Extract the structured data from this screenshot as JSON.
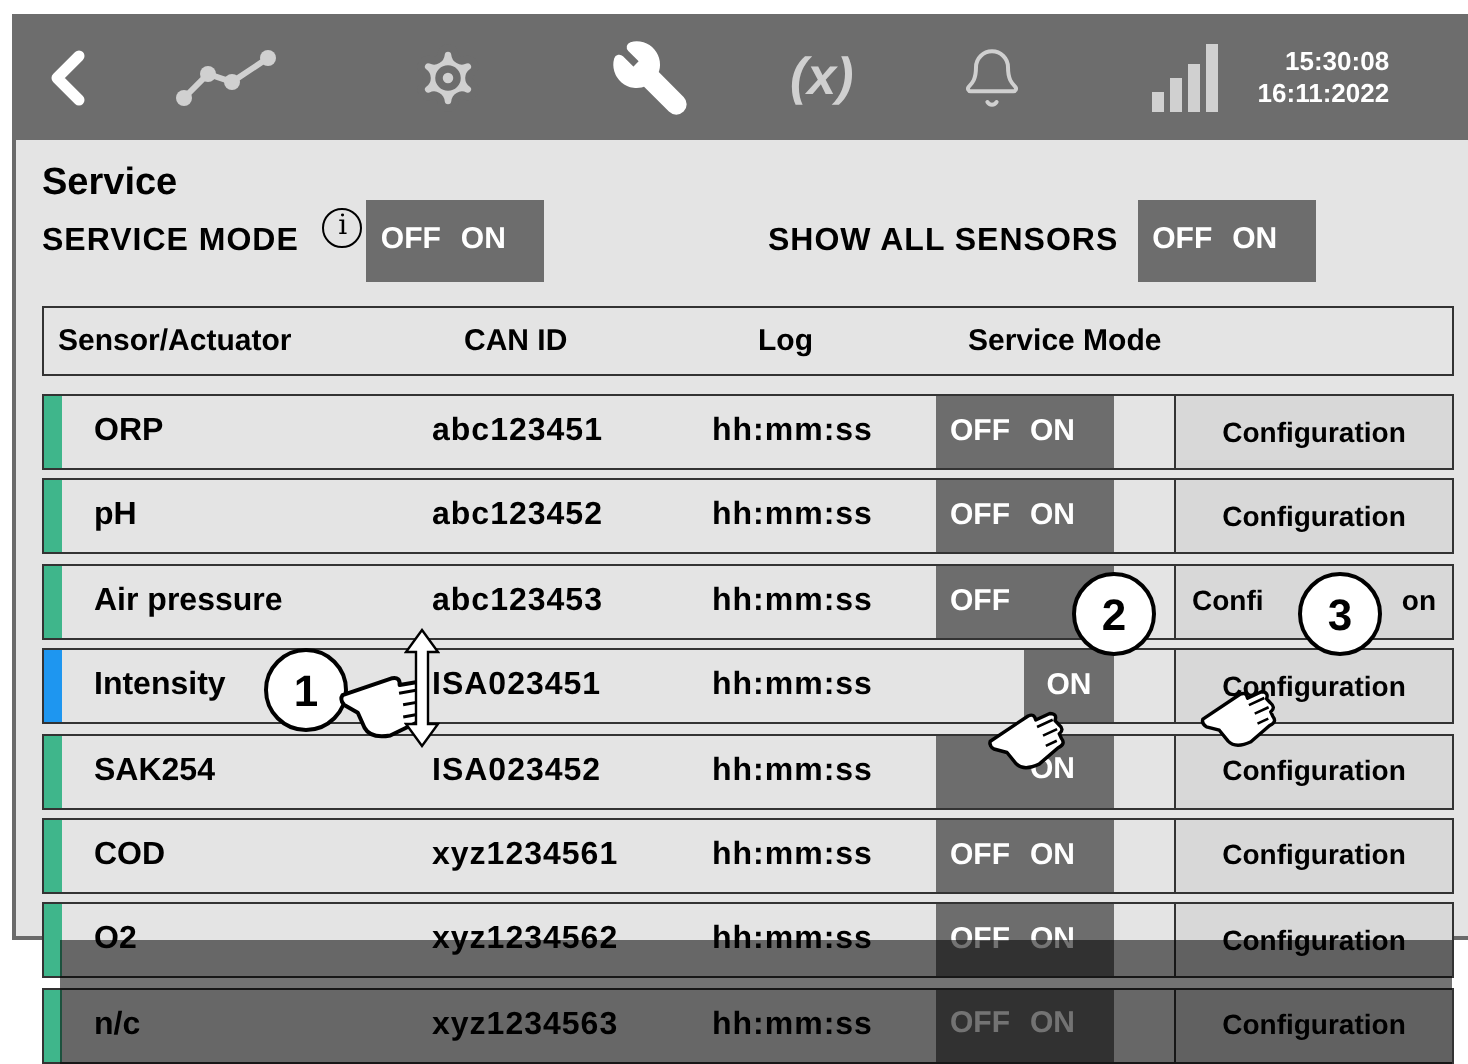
{
  "header": {
    "time": "15:30:08",
    "date": "16:11:2022",
    "variable_label": "(x)"
  },
  "title": "Service",
  "settings": [
    {
      "label": "SERVICE MODE",
      "info": "i",
      "off": "OFF",
      "on": "ON"
    },
    {
      "label": "SHOW ALL SENSORS",
      "off": "OFF",
      "on": "ON"
    }
  ],
  "table": {
    "columns": [
      "Sensor/Actuator",
      "CAN ID",
      "Log",
      "Service Mode"
    ],
    "rows": [
      {
        "name": "ORP",
        "can_id": "abc123451",
        "log": "hh:mm:ss",
        "color": "#3fb68b",
        "toggle": {
          "kind": "full",
          "off": "OFF",
          "on": "ON"
        },
        "action": "Configuration"
      },
      {
        "name": "pH",
        "can_id": "abc123452",
        "log": "hh:mm:ss",
        "color": "#3fb68b",
        "toggle": {
          "kind": "full",
          "off": "OFF",
          "on": "ON"
        },
        "action": "Configuration"
      },
      {
        "name": "Air pressure",
        "can_id": "abc123453",
        "log": "hh:mm:ss",
        "color": "#3fb68b",
        "toggle": {
          "kind": "full",
          "off": "OFF"
        },
        "action": "Confi",
        "action_end": "on"
      },
      {
        "name": "Intensity",
        "can_id": "ISA023451",
        "log": "hh:mm:ss",
        "color": "#1e96f0",
        "toggle": {
          "kind": "on_only",
          "on": "ON"
        },
        "action": "Configuration"
      },
      {
        "name": "SAK254",
        "can_id": "ISA023452",
        "log": "hh:mm:ss",
        "color": "#3fb68b",
        "toggle": {
          "kind": "full",
          "on": "ON"
        },
        "action": "Configuration"
      },
      {
        "name": "COD",
        "can_id": "xyz1234561",
        "log": "hh:mm:ss",
        "color": "#3fb68b",
        "toggle": {
          "kind": "full",
          "off": "OFF",
          "on": "ON"
        },
        "action": "Configuration"
      },
      {
        "name": "O2",
        "can_id": "xyz1234562",
        "log": "hh:mm:ss",
        "color": "#3fb68b",
        "toggle": {
          "kind": "full",
          "off": "OFF",
          "on": "ON"
        },
        "action": "Configuration"
      },
      {
        "name": "n/c",
        "can_id": "xyz1234563",
        "log": "hh:mm:ss",
        "color": "#3fb68b",
        "toggle": {
          "kind": "full",
          "off": "OFF",
          "on": "ON"
        },
        "action": "Configuration"
      }
    ]
  },
  "callouts": [
    {
      "number": "1"
    },
    {
      "number": "2"
    },
    {
      "number": "3"
    }
  ]
}
